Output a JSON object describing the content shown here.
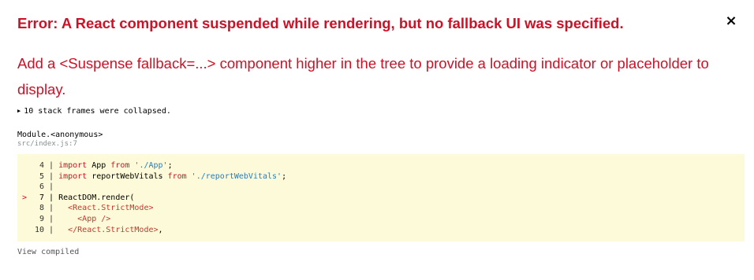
{
  "error": {
    "title": "Error: A React component suspended while rendering, but no fallback UI was specified.",
    "close_label": "×",
    "message": "Add a <Suspense fallback=...> component higher in the tree to provide a loading indicator or placeholder to display."
  },
  "stack": {
    "collapsed_label": "10 stack frames were collapsed.",
    "frame_function": "Module.<anonymous>",
    "frame_location": "src/index.js:7",
    "view_compiled_label": "View compiled"
  },
  "code": {
    "highlighted_line": "7",
    "lines": [
      {
        "number": "4",
        "marker": "",
        "parts": [
          {
            "t": "import",
            "c": "kw"
          },
          {
            "t": " App ",
            "c": "plain"
          },
          {
            "t": "from",
            "c": "kw"
          },
          {
            "t": " ",
            "c": "plain"
          },
          {
            "t": "'./App'",
            "c": "str"
          },
          {
            "t": ";",
            "c": "plain"
          }
        ]
      },
      {
        "number": "5",
        "marker": "",
        "parts": [
          {
            "t": "import",
            "c": "kw"
          },
          {
            "t": " reportWebVitals ",
            "c": "plain"
          },
          {
            "t": "from",
            "c": "kw"
          },
          {
            "t": " ",
            "c": "plain"
          },
          {
            "t": "'./reportWebVitals'",
            "c": "str"
          },
          {
            "t": ";",
            "c": "plain"
          }
        ]
      },
      {
        "number": "6",
        "marker": "",
        "parts": []
      },
      {
        "number": "7",
        "marker": ">",
        "parts": [
          {
            "t": "ReactDOM",
            "c": "plain"
          },
          {
            "t": ".render(",
            "c": "plain"
          }
        ]
      },
      {
        "number": "8",
        "marker": "",
        "parts": [
          {
            "t": "  ",
            "c": "plain"
          },
          {
            "t": "<React.StrictMode>",
            "c": "tag"
          }
        ]
      },
      {
        "number": "9",
        "marker": "",
        "parts": [
          {
            "t": "    ",
            "c": "plain"
          },
          {
            "t": "<App />",
            "c": "tag"
          }
        ]
      },
      {
        "number": "10",
        "marker": "",
        "parts": [
          {
            "t": "  ",
            "c": "plain"
          },
          {
            "t": "</React.StrictMode>",
            "c": "tag"
          },
          {
            "t": ",",
            "c": "plain"
          }
        ]
      }
    ]
  },
  "colors": {
    "error_red": "#ce1126",
    "code_background": "#fcfad9",
    "string_blue": "#1f7ec8",
    "location_gray": "#878e91"
  }
}
